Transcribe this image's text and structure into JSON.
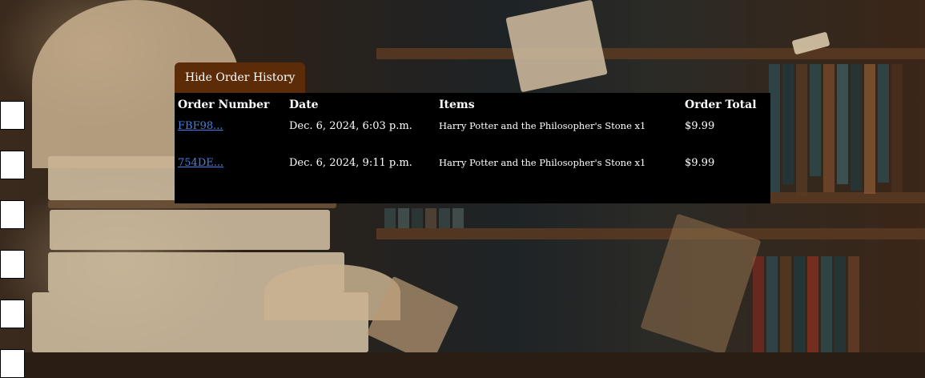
{
  "orders_section": {
    "toggle_label": "Hide Order History",
    "columns": [
      "Order Number",
      "Date",
      "Items",
      "Order Total"
    ],
    "rows": [
      {
        "order_number": "FBF98...",
        "date": "Dec. 6, 2024, 6:03 p.m.",
        "items": "Harry Potter and the Philosopher's Stone x1",
        "total": "$9.99"
      },
      {
        "order_number": "754DE...",
        "date": "Dec. 6, 2024, 9:11 p.m.",
        "items": "Harry Potter and the Philosopher's Stone x1",
        "total": "$9.99"
      }
    ]
  },
  "colors": {
    "button_bg": "#5c2b08",
    "panel_bg": "#000000",
    "link": "#4a7fe0"
  }
}
